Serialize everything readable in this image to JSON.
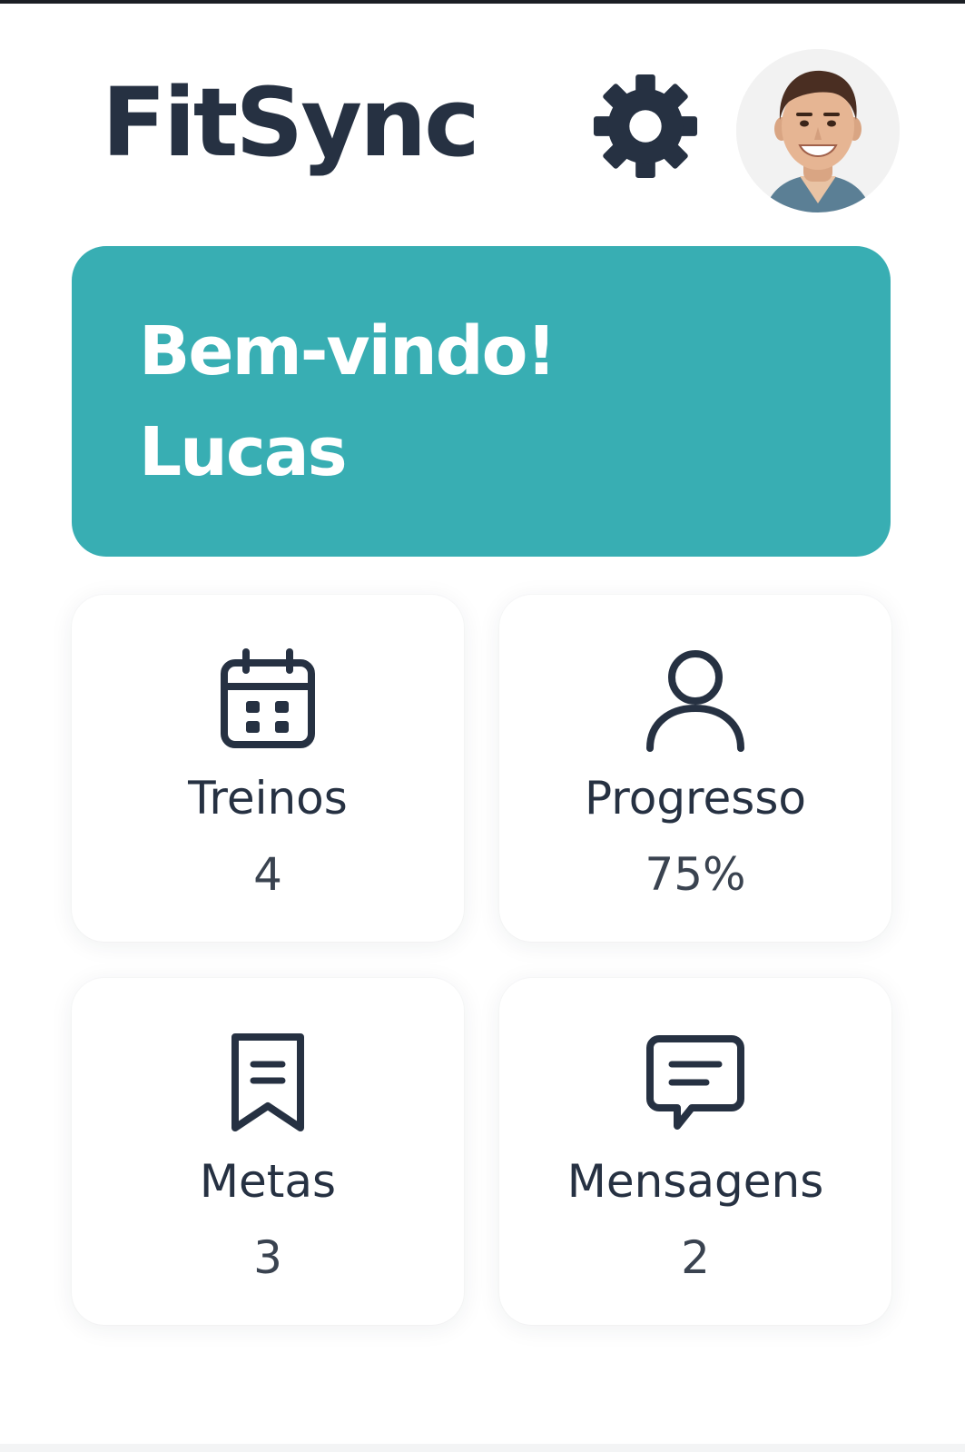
{
  "header": {
    "app_title": "FitSync",
    "settings_icon": "gear-icon",
    "avatar_icon": "user-avatar-photo"
  },
  "welcome": {
    "greeting": "Bem-vindo!",
    "user_name": "Lucas",
    "background_color": "#38aeb3"
  },
  "tiles": [
    {
      "icon": "calendar-icon",
      "label": "Treinos",
      "value": "4"
    },
    {
      "icon": "user-icon",
      "label": "Progresso",
      "value": "75%"
    },
    {
      "icon": "bookmark-list-icon",
      "label": "Metas",
      "value": "3"
    },
    {
      "icon": "message-icon",
      "label": "Mensagens",
      "value": "2"
    }
  ],
  "colors": {
    "text_primary": "#263142",
    "accent": "#38aeb3",
    "background": "#ffffff"
  }
}
